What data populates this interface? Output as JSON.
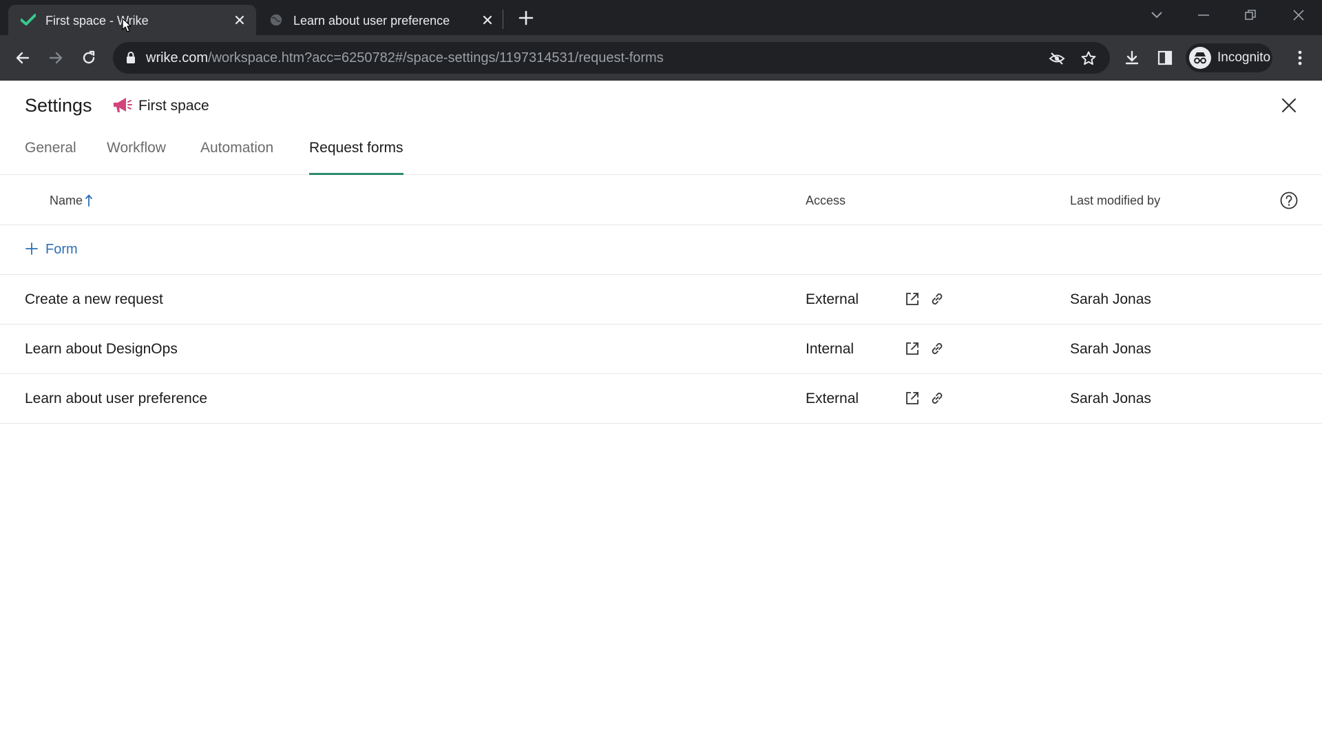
{
  "browser": {
    "tabs": [
      {
        "title": "First space - Wrike",
        "favicon": "wrike-check-icon",
        "active": true
      },
      {
        "title": "Learn about user preference",
        "favicon": "globe-icon",
        "active": false
      }
    ],
    "url_host": "wrike.com",
    "url_path": "/workspace.htm?acc=6250782#/space-settings/1197314531/request-forms",
    "profile_label": "Incognito"
  },
  "page": {
    "title": "Settings",
    "space_name": "First space",
    "space_icon_color": "#d2457a",
    "tabs": [
      {
        "label": "General",
        "active": false
      },
      {
        "label": "Workflow",
        "active": false
      },
      {
        "label": "Automation",
        "active": false
      },
      {
        "label": "Request forms",
        "active": true
      }
    ],
    "accent_color": "#2c8a6e",
    "link_color": "#2f6fb5"
  },
  "table": {
    "columns": {
      "name": "Name",
      "access": "Access",
      "last_modified": "Last modified by"
    },
    "add_label": "Form",
    "rows": [
      {
        "name": "Create a new request",
        "access": "External",
        "modified_by": "Sarah Jonas"
      },
      {
        "name": "Learn about DesignOps",
        "access": "Internal",
        "modified_by": "Sarah Jonas"
      },
      {
        "name": "Learn about user preference",
        "access": "External",
        "modified_by": "Sarah Jonas"
      }
    ]
  }
}
